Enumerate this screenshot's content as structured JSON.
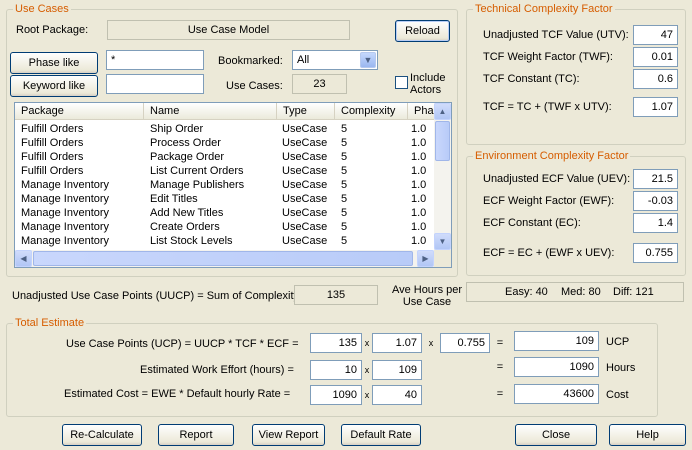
{
  "use_cases": {
    "title": "Use Cases",
    "root_package_label": "Root Package:",
    "root_package_value": "Use Case Model",
    "reload_label": "Reload",
    "phase_like_label": "Phase like",
    "phase_like_value": "*",
    "keyword_like_label": "Keyword like",
    "keyword_like_value": "",
    "bookmarked_label": "Bookmarked:",
    "bookmarked_value": "All",
    "use_cases_label": "Use Cases:",
    "use_cases_count": "23",
    "include_actors_label": "Include Actors",
    "include_actors_checked": false,
    "columns": [
      "Package",
      "Name",
      "Type",
      "Complexity",
      "Pha"
    ],
    "rows": [
      [
        "Fulfill Orders",
        "Ship Order",
        "UseCase",
        "5",
        "1.0"
      ],
      [
        "Fulfill Orders",
        "Process Order",
        "UseCase",
        "5",
        "1.0"
      ],
      [
        "Fulfill Orders",
        "Package Order",
        "UseCase",
        "5",
        "1.0"
      ],
      [
        "Fulfill Orders",
        "List Current Orders",
        "UseCase",
        "5",
        "1.0"
      ],
      [
        "Manage Inventory",
        "Manage Publishers",
        "UseCase",
        "5",
        "1.0"
      ],
      [
        "Manage Inventory",
        "Edit Titles",
        "UseCase",
        "5",
        "1.0"
      ],
      [
        "Manage Inventory",
        "Add New Titles",
        "UseCase",
        "5",
        "1.0"
      ],
      [
        "Manage Inventory",
        "Create Orders",
        "UseCase",
        "5",
        "1.0"
      ],
      [
        "Manage Inventory",
        "List Stock Levels",
        "UseCase",
        "5",
        "1.0"
      ]
    ]
  },
  "tcf": {
    "title": "Technical Complexity Factor",
    "utv_label": "Unadjusted TCF Value (UTV):",
    "utv_value": "47",
    "twf_label": "TCF Weight Factor (TWF):",
    "twf_value": "0.01",
    "tc_label": "TCF Constant (TC):",
    "tc_value": "0.6",
    "formula_label": "TCF = TC + (TWF x UTV):",
    "formula_value": "1.07"
  },
  "ecf": {
    "title": "Environment Complexity Factor",
    "uev_label": "Unadjusted ECF Value (UEV):",
    "uev_value": "21.5",
    "ewf_label": "ECF Weight Factor (EWF):",
    "ewf_value": "-0.03",
    "ec_label": "ECF Constant (EC):",
    "ec_value": "1.4",
    "formula_label": "ECF  = EC + (EWF x UEV):",
    "formula_value": "0.755"
  },
  "uucp": {
    "label": "Unadjusted Use Case Points (UUCP) = Sum of Complexity",
    "value": "135",
    "ave_hours_label": "Ave Hours per Use Case",
    "easy": "Easy: 40",
    "med": "Med: 80",
    "diff": "Diff: 121"
  },
  "total": {
    "title": "Total Estimate",
    "ucp_label": "Use Case Points (UCP) = UUCP * TCF * ECF =",
    "ucp_uucp": "135",
    "ucp_tcf": "1.07",
    "ucp_ecf": "0.755",
    "ucp_result": "109",
    "ucp_unit": "UCP",
    "ewe_label": "Estimated Work Effort (hours) =",
    "ewe_a": "10",
    "ewe_b": "109",
    "ewe_result": "1090",
    "ewe_unit": "Hours",
    "cost_label": "Estimated Cost  = EWE * Default hourly Rate =",
    "cost_a": "1090",
    "cost_b": "40",
    "cost_result": "43600",
    "cost_unit": "Cost",
    "times": "x",
    "equals": "="
  },
  "buttons": {
    "recalculate": "Re-Calculate",
    "report": "Report",
    "view_report": "View Report",
    "default_rate": "Default Rate",
    "close": "Close",
    "help": "Help"
  },
  "colors": {
    "group_title": "#d65d00",
    "dialog_bg": "#ece9d8",
    "field_border": "#7f9db9"
  }
}
